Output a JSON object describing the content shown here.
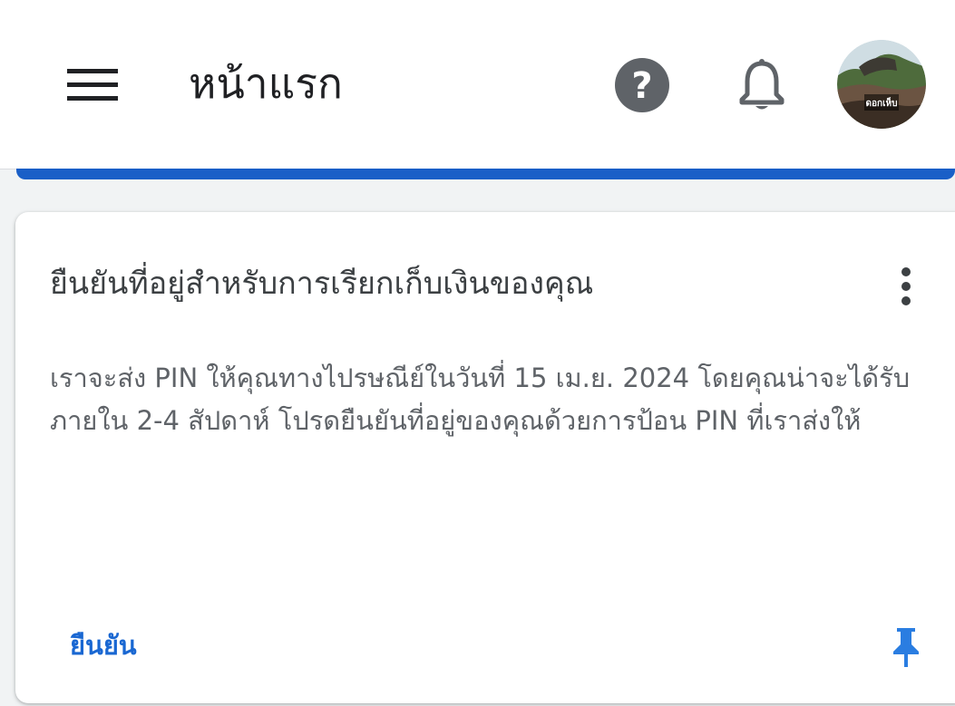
{
  "header": {
    "title": "หน้าแรก",
    "menu_icon": "hamburger-menu-icon",
    "help_icon": "help-circle-icon",
    "notifications_icon": "bell-icon",
    "avatar_text": "ดอกเห็บ"
  },
  "card": {
    "title": "ยืนยันที่อยู่สำหรับการเรียกเก็บเงินของคุณ",
    "body": "เราจะส่ง PIN ให้คุณทางไปรษณีย์ในวันที่ 15 เม.ย. 2024 โดยคุณน่าจะได้รับภายใน 2-4 สัปดาห์ โปรดยืนยันที่อยู่ของคุณด้วยการป้อน PIN ที่เราส่งให้",
    "action_label": "ยืนยัน",
    "more_icon": "more-vertical-icon",
    "pin_icon": "pin-icon"
  },
  "colors": {
    "accent": "#1967d2",
    "progress": "#1a5fc7",
    "icon_gray": "#5f6368",
    "pin_blue": "#2a7de1"
  }
}
